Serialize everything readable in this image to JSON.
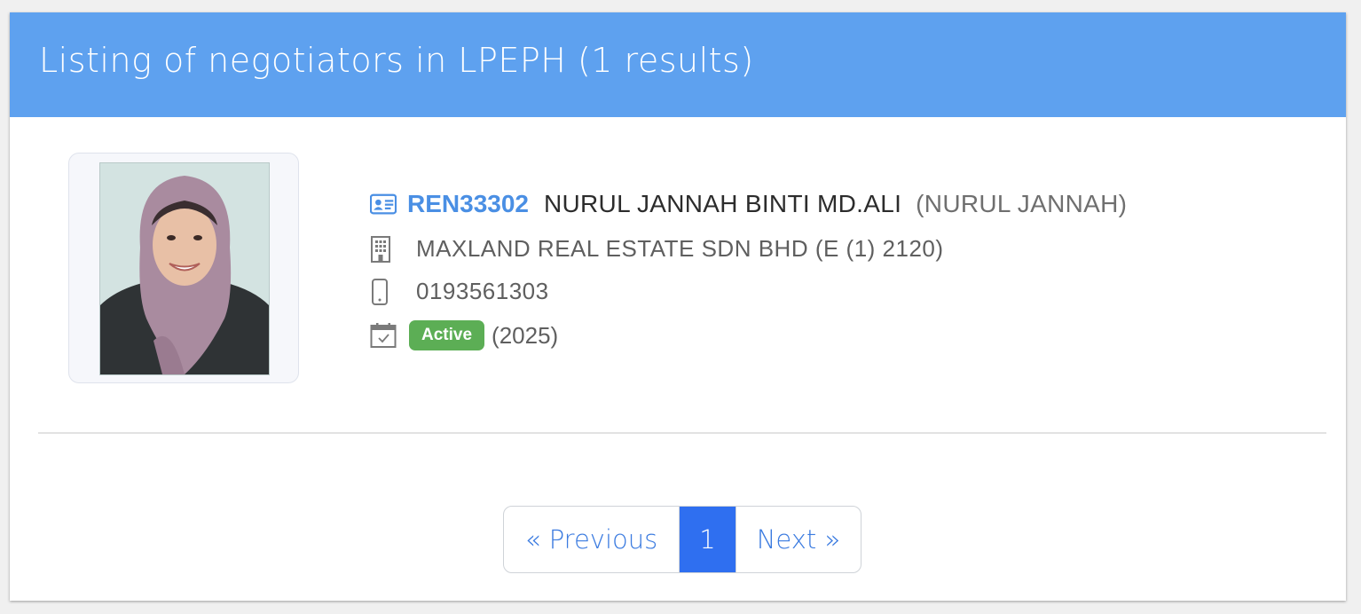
{
  "header": {
    "title": "Listing of negotiators in LPEPH (1 results)",
    "background_color": "#5ea1ef"
  },
  "negotiator": {
    "photo_alt": "negotiator portrait",
    "ren_number": "REN33302",
    "full_name": "NURUL JANNAH BINTI MD.ALI",
    "alias": "(NURUL JANNAH)",
    "agency": "MAXLAND REAL ESTATE SDN BHD (E (1) 2120)",
    "phone": "0193561303",
    "status": "Active",
    "status_color": "#5cae55",
    "year": "(2025)",
    "icons": {
      "ren": "id-card-icon",
      "agency": "building-icon",
      "phone": "mobile-phone-icon",
      "status": "calendar-check-icon"
    }
  },
  "pagination": {
    "previous_label": "« Previous",
    "current_page": "1",
    "next_label": "Next »",
    "active_color": "#2f6ff0"
  }
}
